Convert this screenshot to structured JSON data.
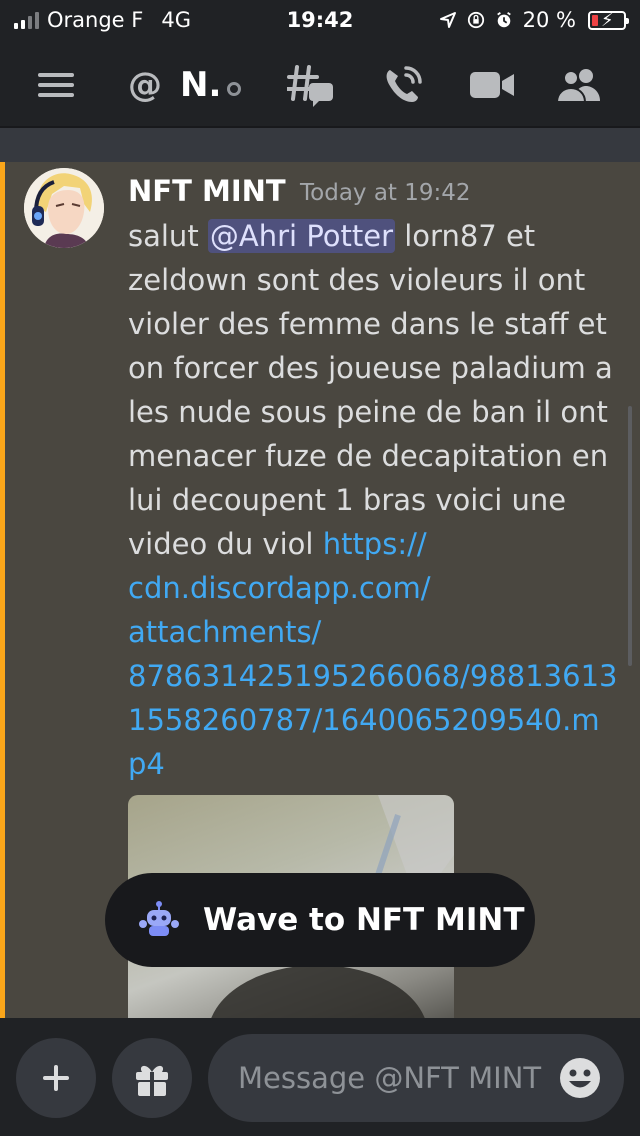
{
  "status_bar": {
    "carrier": "Orange F",
    "network": "4G",
    "time": "19:42",
    "battery_percent": "20 %",
    "battery_level": 0.2,
    "icons": [
      "signal-icon",
      "location-icon",
      "lock-rotation-icon",
      "alarm-icon",
      "battery-icon"
    ]
  },
  "header": {
    "at_symbol": "@",
    "channel_name": "N.",
    "icons": [
      "menu-icon",
      "threads-icon",
      "call-icon",
      "video-icon",
      "members-icon"
    ]
  },
  "message": {
    "author": "NFT MINT",
    "timestamp": "Today at 19:42",
    "lines": {
      "l1_pre": "salut ",
      "mention": "@Ahri Potter",
      "l1_post": " lorn87 et",
      "l2": "zeldown sont des violeurs il ont",
      "l3": "violer des femme dans le staff et",
      "l4": "on forcer des joueuse paladium a",
      "l5": "les nude sous peine de ban il ont",
      "l6": "menacer fuze de decapitation en",
      "l7": "lui decoupent 1 bras voici une",
      "l8_pre": "video du viol ",
      "link1": "https://",
      "link2": "cdn.discordapp.com/",
      "link3": "attachments/",
      "link4": "878631425195266068/98813613",
      "link5": "1558260787/1640065209540.m",
      "link6": "p4"
    }
  },
  "wave_button": {
    "label": "Wave to NFT MINT"
  },
  "composer": {
    "placeholder": "Message @NFT MINT"
  },
  "colors": {
    "mention_highlight_bar": "#faa61a",
    "link": "#41a9f3",
    "background": "#36393f",
    "header": "#202225"
  }
}
